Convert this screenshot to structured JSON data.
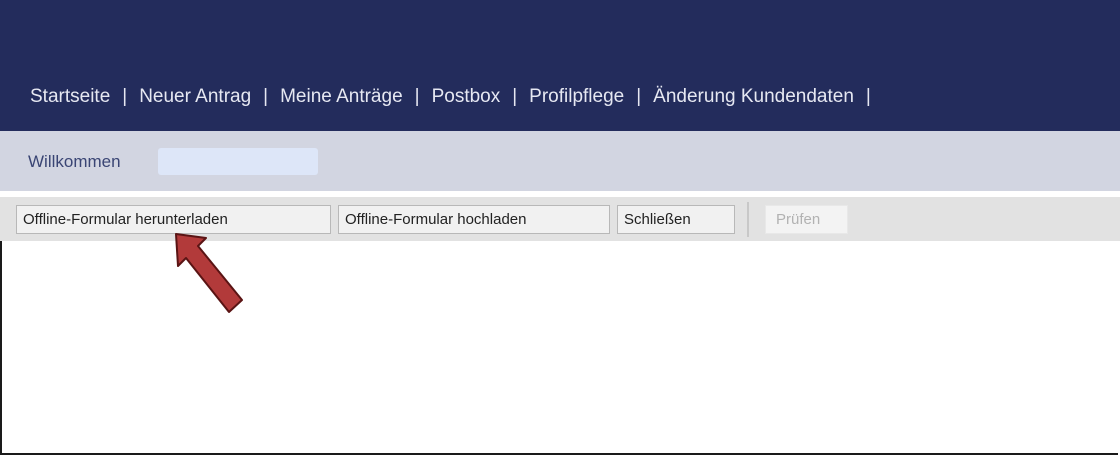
{
  "nav": {
    "items": [
      "Startseite",
      "Neuer Antrag",
      "Meine Anträge",
      "Postbox",
      "Profilpflege",
      "Änderung Kundendaten"
    ],
    "separator": "|"
  },
  "welcome": {
    "label": "Willkommen",
    "user_name": ""
  },
  "toolbar": {
    "download_label": "Offline-Formular herunterladen",
    "upload_label": "Offline-Formular hochladen",
    "close_label": "Schließen",
    "check_label": "Prüfen"
  },
  "annotation": {
    "icon": "red-arrow-icon",
    "color": "#b23a3a"
  },
  "colors": {
    "header": "#232c5c",
    "welcome_bar": "#d2d5e1",
    "toolbar": "#e2e2e2"
  }
}
